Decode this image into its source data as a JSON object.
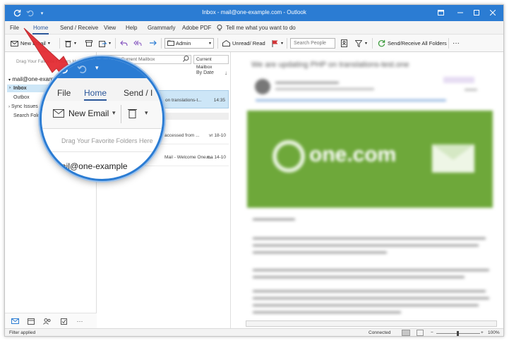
{
  "colors": {
    "accent": "#2b7cd3",
    "ribbon_tab_active": "#2b579a",
    "selection": "#cde6f7",
    "arrow_red": "#e3262d",
    "banner_green": "#6ea83a"
  },
  "window": {
    "title": "Inbox - mail@one-example.com - Outlook"
  },
  "quick_access": {
    "icons": [
      "sync-icon",
      "undo-icon",
      "customize-icon"
    ]
  },
  "menubar": {
    "items": [
      "File",
      "Home",
      "Send / Receive",
      "View",
      "Help",
      "Grammarly",
      "Adobe PDF"
    ],
    "active": "Home",
    "tell_me": "Tell me what you want to do"
  },
  "toolbar": {
    "new_email": "New Email",
    "move_to_folder": "Admin",
    "unread_read": "Unread/ Read",
    "search_people_placeholder": "Search People",
    "send_receive_all": "Send/Receive All Folders",
    "more": "···"
  },
  "folder_pane": {
    "favorites_hint": "Drag Your Favorite Folders Here",
    "account": "mail@one-exam",
    "folders": [
      "Inbox",
      "Outbox",
      "Sync Issues (",
      "Search Folde"
    ],
    "selected": "Inbox",
    "collapse": "‹"
  },
  "message_list": {
    "search_placeholder": "Search Current Mailbox",
    "scope": "Current Mailbox",
    "sort_label": "By Date",
    "sort_direction": "↓",
    "header_partial": "ead",
    "messages": [
      {
        "subject": "on translations-t...",
        "time": "14:35",
        "selected": true
      },
      {
        "subject": "accessed from ...",
        "time": "vr 18-10",
        "selected": false
      },
      {
        "subject": "Mail - Welcome One.c...",
        "time": "ma 14-10",
        "selected": false
      }
    ]
  },
  "reading_pane": {
    "subject": "We are updating PHP on translations-test.one",
    "banner_brand": "one.com"
  },
  "statusbar": {
    "left": "Filter applied",
    "connection": "Connected",
    "zoom": "100%",
    "zoom_minus": "−",
    "zoom_plus": "+"
  },
  "magnifier": {
    "menu_items": [
      "File",
      "Home",
      "Send / I"
    ],
    "active": "Home",
    "new_email": "New Email",
    "favorites_hint": "Drag Your Favorite Folders Here",
    "account": "mail@one-example"
  }
}
